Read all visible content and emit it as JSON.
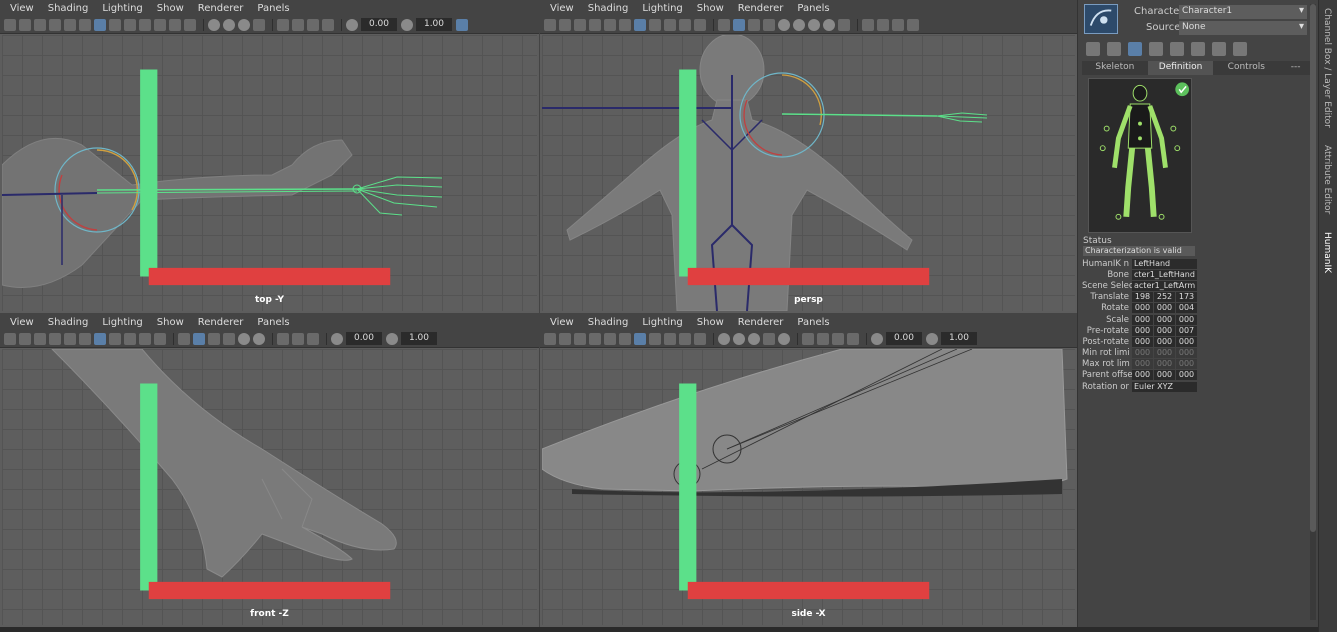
{
  "viewport_menu": [
    "View",
    "Shading",
    "Lighting",
    "Show",
    "Renderer",
    "Panels"
  ],
  "viewports": [
    {
      "label": "top -Y",
      "field_a": "0.00",
      "field_b": "1.00"
    },
    {
      "label": "persp",
      "field_a": "0.00",
      "field_b": "1.00"
    },
    {
      "label": "front -Z",
      "field_a": "0.00",
      "field_b": "1.00"
    },
    {
      "label": "side -X",
      "field_a": "0.00",
      "field_b": "1.00"
    }
  ],
  "hik": {
    "character_label": "Character:",
    "character_value": "Character1",
    "source_label": "Source:",
    "source_value": "None",
    "tabs": [
      "Skeleton",
      "Definition",
      "Controls",
      "---"
    ],
    "active_tab": "Definition",
    "status_label": "Status",
    "status_text": "Characterization is valid",
    "attributes": [
      {
        "name": "HumanIK n",
        "values": [
          "LeftHand"
        ]
      },
      {
        "name": "Bone",
        "values": [
          "cter1_LeftHand"
        ]
      },
      {
        "name": "Scene Selec",
        "values": [
          "acter1_LeftArm"
        ]
      },
      {
        "name": "Translate",
        "values": [
          "198",
          "252",
          "173"
        ]
      },
      {
        "name": "Rotate",
        "values": [
          "000",
          "000",
          "004"
        ]
      },
      {
        "name": "Scale",
        "values": [
          "000",
          "000",
          "000"
        ]
      },
      {
        "name": "Pre-rotate",
        "values": [
          "000",
          "000",
          "007"
        ]
      },
      {
        "name": "Post-rotate",
        "values": [
          "000",
          "000",
          "000"
        ]
      },
      {
        "name": "Min rot limi",
        "values": [
          "000",
          "000",
          "000"
        ],
        "dim": true
      },
      {
        "name": "Max rot lim",
        "values": [
          "000",
          "000",
          "000"
        ],
        "dim": true
      },
      {
        "name": "Parent offse",
        "values": [
          "000",
          "000",
          "000"
        ]
      },
      {
        "name": "Rotation or",
        "values": [
          "Euler XYZ"
        ]
      }
    ]
  },
  "side_tabs": [
    "Channel Box / Layer Editor",
    "Attribute Editor",
    "HumanIK"
  ]
}
